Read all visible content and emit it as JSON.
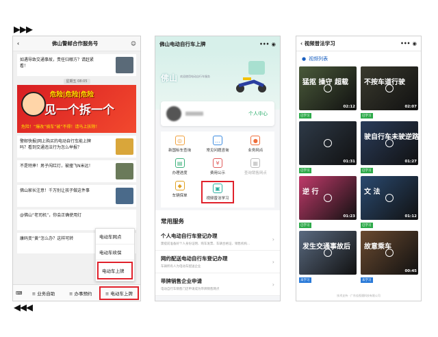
{
  "arrows": {
    "top": "▶▶▶",
    "bottom": "◀◀◀"
  },
  "p1": {
    "title": "佛山警邮合作服务号",
    "messages": [
      {
        "text": "如遇导致交通事故，责任归哪方？请赶紧看！"
      },
      {
        "time": "星期五 08:05"
      },
      {
        "banner_line1": "危险|危险|危险",
        "banner_line2": "见一个拆一个",
        "banner_line3": "危险！“爆改”骑车“被”不得！请马上拆除！"
      },
      {
        "text": "警邮快报|网上购买的电动自行车能上牌吗？看到交通违法行为怎么举报？"
      },
      {
        "text": "不是特摔！男子闯红灯，被撞飞N米远！"
      },
      {
        "text": "佛山家长注意！千万别让孩子做这件事"
      },
      {
        "text": "@佛山“老司机”，你会正确使用灯"
      },
      {
        "text": "康码变“黄”怎么办？这样可转"
      }
    ],
    "popup": [
      "电动车网点",
      "电动车续保",
      "电动车上牌"
    ],
    "tabs": [
      "业务自助",
      "办事预约",
      "电动车上牌"
    ]
  },
  "p2": {
    "title": "佛山电动自行车上牌",
    "city": "佛山",
    "city_sub": "欢迎使用电动自行车服务",
    "personal_center": "个人中心",
    "grid": [
      {
        "label": "新国标车查询",
        "icon": "search-icon",
        "color": "#f0a03c"
      },
      {
        "label": "常见问题咨询",
        "icon": "chat-icon",
        "color": "#3b8be0"
      },
      {
        "label": "业务网点",
        "icon": "location-icon",
        "color": "#ef6d3a"
      },
      {
        "label": "办理进度",
        "icon": "progress-icon",
        "color": "#3bb07a"
      },
      {
        "label": "费用公示",
        "icon": "fee-icon",
        "color": "#e05a5a"
      },
      {
        "label": "查询销售网点",
        "icon": "store-icon",
        "color": "#bbbbbb"
      },
      {
        "label": "车辆保单",
        "icon": "shield-icon",
        "color": "#e0a020"
      },
      {
        "label": "视频普法学习",
        "icon": "video-icon",
        "color": "#2bb0a0"
      }
    ],
    "section_title": "常用服务",
    "services": [
      {
        "title": "个人电动自行车登记办理",
        "desc": "需提前准备好个人身份证明、购车发票、车辆合格证、销售机构..."
      },
      {
        "title": "网约配送电动自行车登记办理",
        "desc": "车辆所有人为电动车配送企业"
      },
      {
        "title": "带牌销售企业申请",
        "desc": "电动自行车销售门店申请成为带牌销售网点"
      }
    ]
  },
  "p3": {
    "title": "视频普法学习",
    "list_title": "视频列表",
    "videos": [
      {
        "caption": "猛抠 操守 超载",
        "duration": "02:12",
        "tag": "已学习",
        "color": "#4a5a3a"
      },
      {
        "caption": "不按车道行驶",
        "duration": "02:07",
        "tag": "已学习",
        "color": "#3a3a2e"
      },
      {
        "caption": "",
        "duration": "01:31",
        "tag": "已学习",
        "color": "#2e3a48"
      },
      {
        "caption": "驶自行车未驶逆路",
        "duration": "01:27",
        "tag": "已学习",
        "color": "#2a3c5a"
      },
      {
        "caption": "逆 行",
        "duration": "01:23",
        "tag": "已学习",
        "color": "#c03a6a"
      },
      {
        "caption": "文 法",
        "duration": "01:12",
        "tag": "已学习",
        "color": "#2a4a70"
      },
      {
        "caption": "发生交通事故后",
        "duration": "",
        "tag": "未学习",
        "color": "#5a6a80"
      },
      {
        "caption": "故意乘车",
        "duration": "00:45",
        "tag": "未学习",
        "color": "#6a4a30"
      }
    ],
    "footer": "技术支持 · 广东佳视通科技有限公司"
  }
}
